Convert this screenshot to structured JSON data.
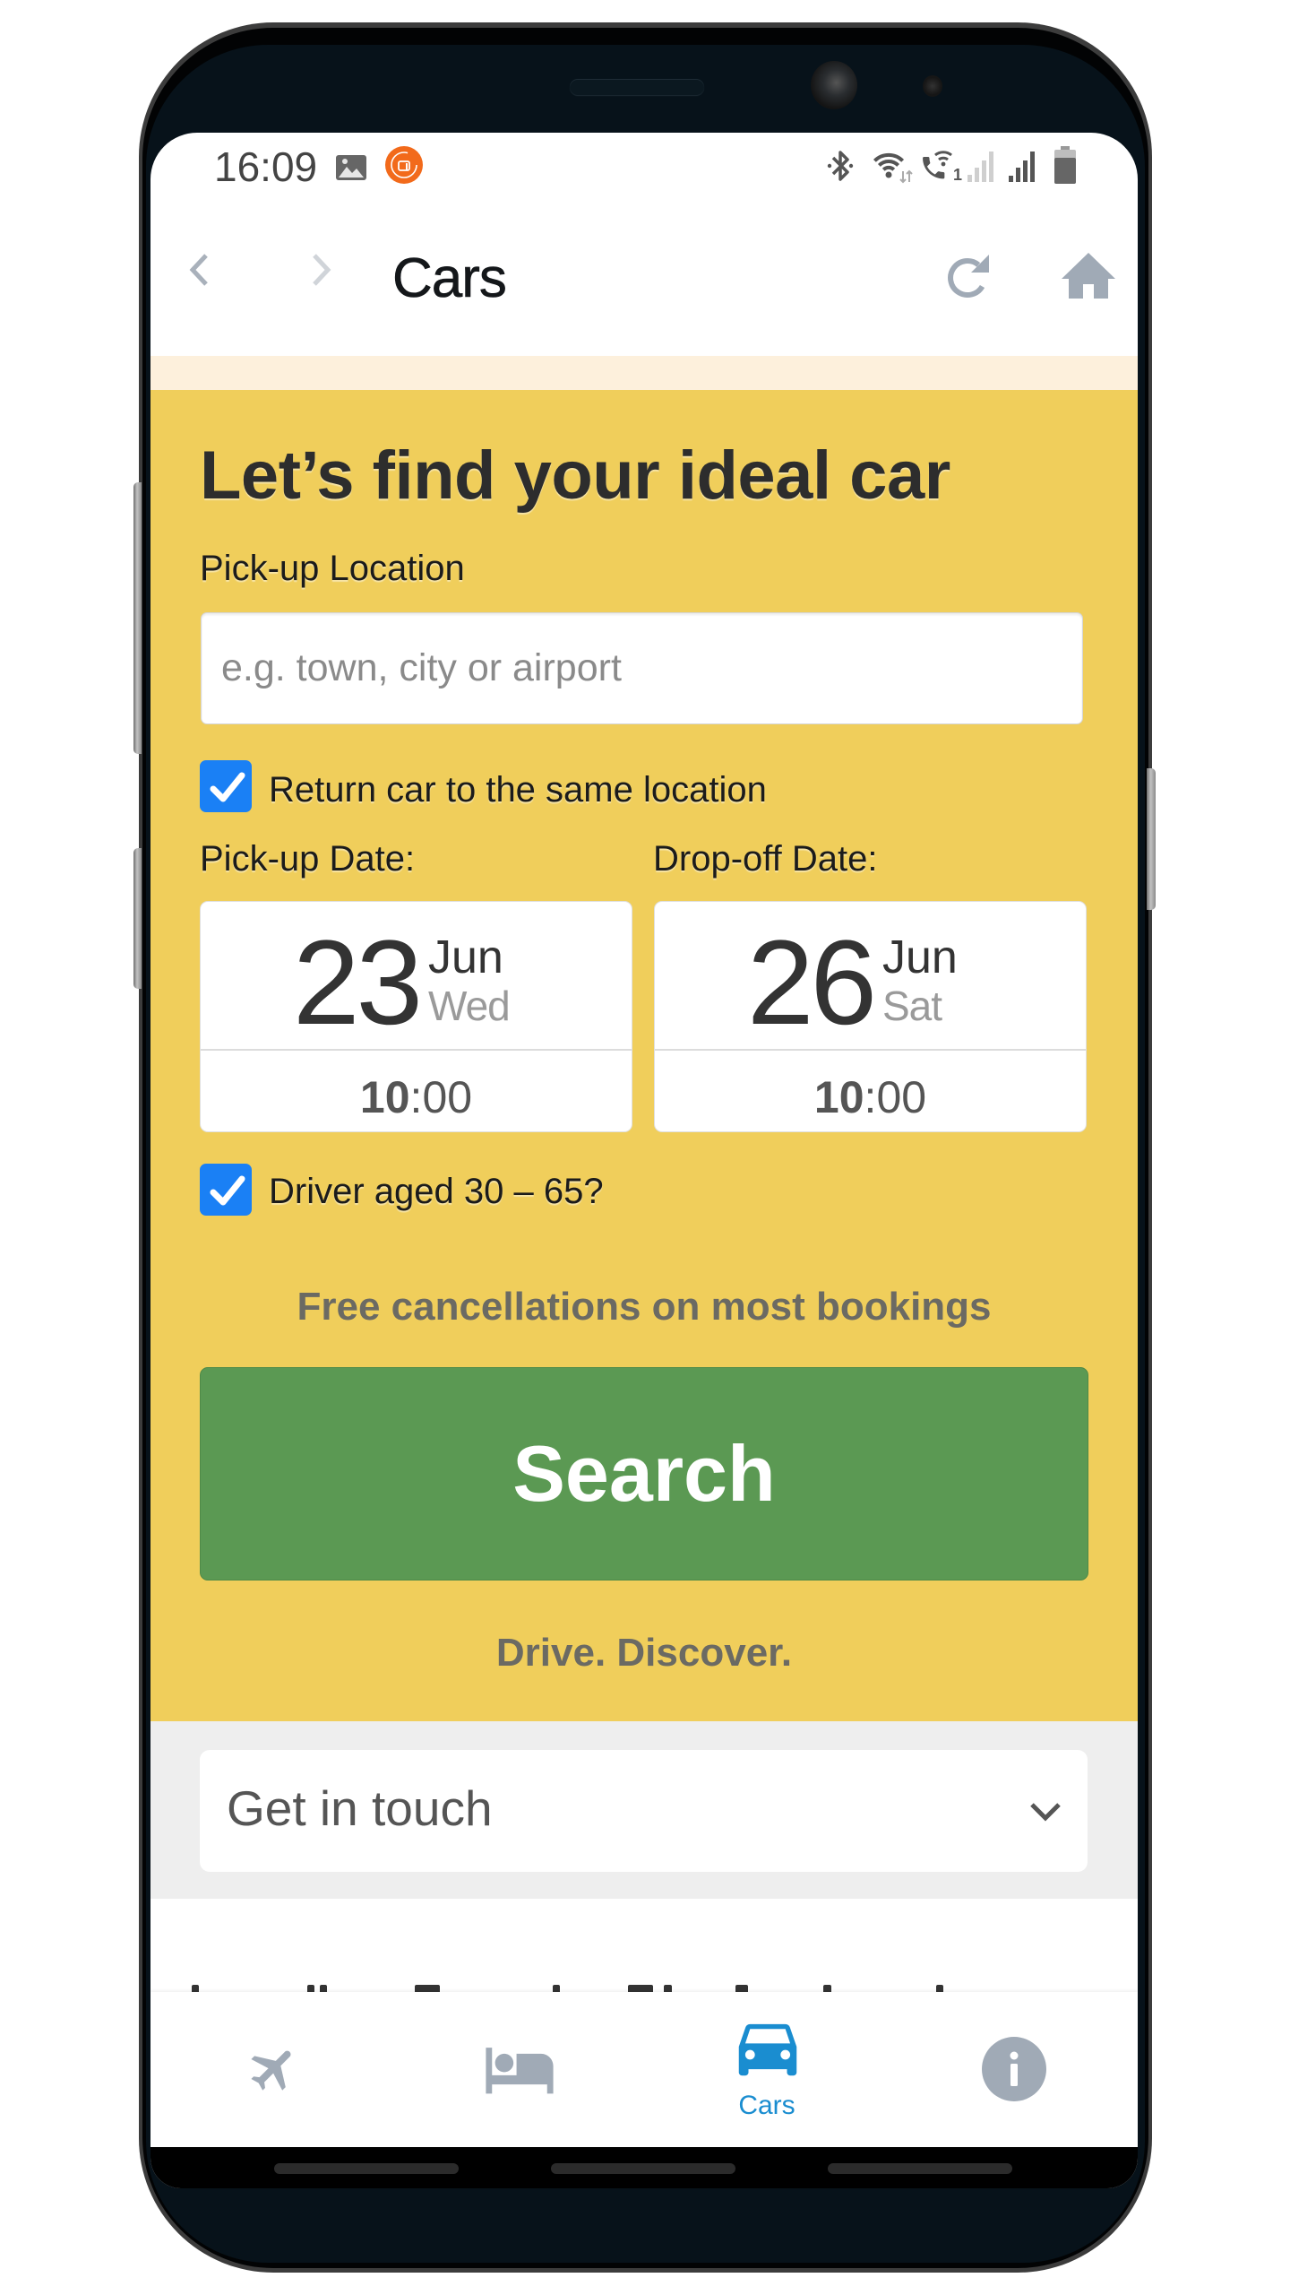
{
  "status_bar": {
    "time": "16:09",
    "notification_icons": [
      "gallery-icon",
      "app-notification-icon"
    ],
    "system_icons": [
      "bluetooth-icon",
      "wifi-icon",
      "wifi-calling-icon",
      "signal-sim1-icon",
      "signal-sim2-icon",
      "battery-icon"
    ],
    "wifi_calling_sim": "1"
  },
  "header": {
    "title": "Cars",
    "back_icon": "chevron-left-icon",
    "forward_icon": "chevron-right-icon",
    "refresh_icon": "refresh-icon",
    "home_icon": "home-icon"
  },
  "search_form": {
    "heading": "Let’s find your ideal car",
    "pickup_location": {
      "label": "Pick-up Location",
      "placeholder": "e.g. town, city or airport",
      "value": ""
    },
    "return_same_location": {
      "label": "Return car to the same location",
      "checked": true
    },
    "pickup_date": {
      "label": "Pick-up Date:",
      "day": "23",
      "month": "Jun",
      "weekday": "Wed",
      "time": {
        "hours": "10",
        "separator": ":",
        "minutes": "00"
      }
    },
    "dropoff_date": {
      "label": "Drop-off Date:",
      "day": "26",
      "month": "Jun",
      "weekday": "Sat",
      "time": {
        "hours": "10",
        "separator": ":",
        "minutes": "00"
      }
    },
    "driver_age": {
      "label": "Driver aged 30 – 65?",
      "checked": true
    },
    "promo": "Free cancellations on most bookings",
    "search_button": "Search",
    "tagline": "Drive. Discover."
  },
  "get_in_touch": {
    "label": "Get in touch",
    "icon": "chevron-down-icon"
  },
  "tab_bar": {
    "items": [
      {
        "id": "flights",
        "icon": "plane-icon",
        "label": "",
        "active": false
      },
      {
        "id": "hotels",
        "icon": "bed-icon",
        "label": "",
        "active": false
      },
      {
        "id": "cars",
        "icon": "car-icon",
        "label": "Cars",
        "active": true
      },
      {
        "id": "info",
        "icon": "info-icon",
        "label": "",
        "active": false
      }
    ]
  },
  "colors": {
    "accent_yellow": "#f0ce5b",
    "notice_cream": "#fdf0dc",
    "search_green": "#5b9953",
    "checkbox_blue": "#1a80f5",
    "active_tab": "#1a8dd0",
    "icon_gray": "#a0aab6",
    "muted_text": "#6b6a63",
    "section_gray": "#eeeeee"
  }
}
